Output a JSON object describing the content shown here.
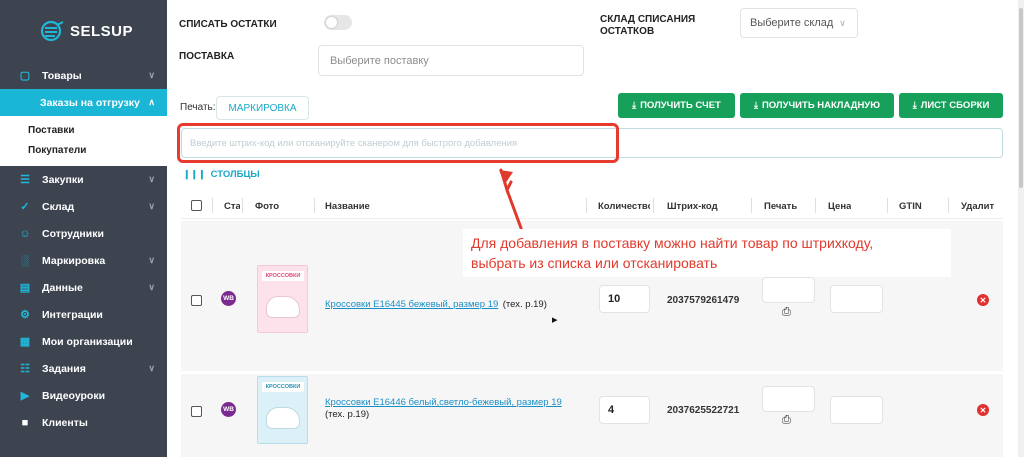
{
  "brand": {
    "name": "SELSUP"
  },
  "sidebar": {
    "items": [
      {
        "label": "Товары",
        "icon": "bag-icon",
        "chevron": true
      },
      {
        "label": "Заказы на отгрузку",
        "active": true,
        "chevron": true
      },
      {
        "label": "Закупки",
        "icon": "cart-icon",
        "chevron": true
      },
      {
        "label": "Склад",
        "icon": "check-circle-icon",
        "chevron": true
      },
      {
        "label": "Сотрудники",
        "icon": "person-icon",
        "chevron": false
      },
      {
        "label": "Маркировка",
        "icon": "barcode-icon",
        "chevron": true
      },
      {
        "label": "Данные",
        "icon": "document-icon",
        "chevron": true
      },
      {
        "label": "Интеграции",
        "icon": "gears-icon",
        "chevron": false
      },
      {
        "label": "Мои организации",
        "icon": "building-icon",
        "chevron": false
      },
      {
        "label": "Задания",
        "icon": "list-icon",
        "chevron": true
      },
      {
        "label": "Видеоуроки",
        "icon": "play-icon",
        "chevron": false
      },
      {
        "label": "Клиенты",
        "icon": "lock-icon",
        "chevron": false
      }
    ],
    "subitems": [
      "Поставки",
      "Покупатели"
    ]
  },
  "form": {
    "writeoff_label": "СПИСАТЬ ОСТАТКИ",
    "supply_label": "ПОСТАВКА",
    "supply_placeholder": "Выберите поставку",
    "warehouse_label_line1": "СКЛАД СПИСАНИЯ",
    "warehouse_label_line2": "ОСТАТКОВ",
    "warehouse_placeholder": "Выберите склад"
  },
  "toolbar": {
    "print_label": "Печать:",
    "marking_tab": "МАРКИРОВКА",
    "get_invoice": "ПОЛУЧИТЬ СЧЕТ",
    "get_waybill": "ПОЛУЧИТЬ НАКЛАДНУЮ",
    "assembly_sheet": "ЛИСТ СБОРКИ"
  },
  "barcode_input": {
    "placeholder": "Введите штрих-код или отсканируйте сканером для быстрого добавления"
  },
  "columns_link": "СТОЛБЦЫ",
  "table": {
    "headers": [
      "Ста",
      "Фото",
      "Название",
      "Количество",
      "Штрих-код",
      "Печать",
      "Цена",
      "GTIN",
      "Удалит"
    ],
    "rows": [
      {
        "marketplace": "WB",
        "photo_tag": "КРОССОВКИ",
        "name": "Кроссовки E16445 бежевый, размер 19",
        "note": "(тех. р.19)",
        "quantity": "10",
        "barcode": "2037579261479",
        "price": ""
      },
      {
        "marketplace": "WB",
        "photo_tag": "КРОССОВКИ",
        "name": "Кроссовки E16446 белый,светло-бежевый, размер 19",
        "note": "(тех. р.19)",
        "quantity": "4",
        "barcode": "2037625522721",
        "price": ""
      }
    ]
  },
  "annotation": {
    "line1": "Для добавления в поставку можно найти товар по штрихкоду,",
    "line2": "выбрать из списка или отсканировать"
  },
  "colors": {
    "sidebar_bg": "#3d4450",
    "accent": "#1ab6d6",
    "green_button": "#16a05a",
    "annotation_red": "#e63b2e",
    "wb_purple": "#7b2a8f"
  }
}
